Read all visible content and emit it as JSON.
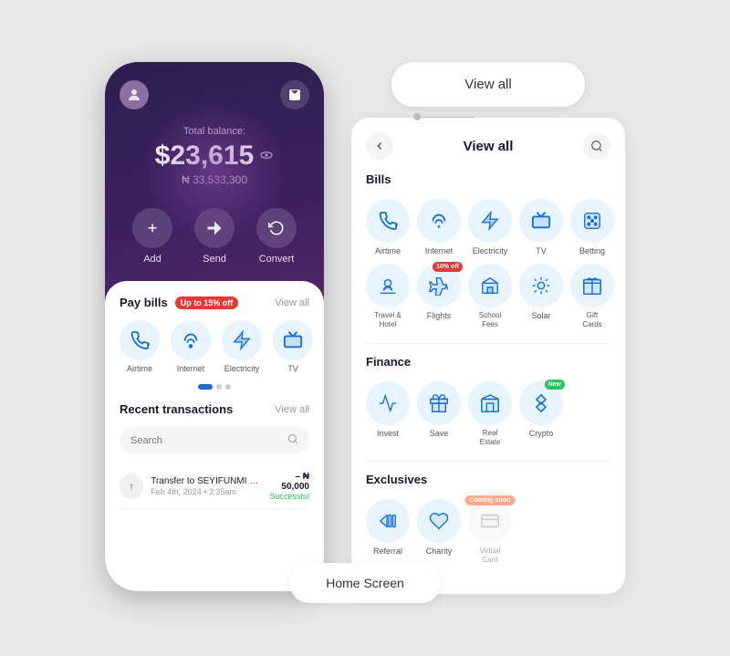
{
  "layout": {
    "background_color": "#e8e8e8"
  },
  "home_screen": {
    "label": "Home Screen",
    "header": {
      "avatar_text": "👤",
      "mail_icon": "✉"
    },
    "balance": {
      "label": "Total balance:",
      "amount": "$23,615",
      "naira": "₦ 33,533,300"
    },
    "actions": [
      {
        "label": "Add",
        "icon": "+"
      },
      {
        "label": "Send",
        "icon": "▲"
      },
      {
        "label": "Convert",
        "icon": "↻"
      }
    ],
    "pay_bills": {
      "title": "Pay bills",
      "badge": "Up to 15% off",
      "view_all": "View all",
      "items": [
        {
          "label": "Airtime",
          "icon": "📞"
        },
        {
          "label": "Internet",
          "icon": "📶"
        },
        {
          "label": "Electricity",
          "icon": "⚡"
        },
        {
          "label": "TV",
          "icon": "📺"
        }
      ]
    },
    "recent_transactions": {
      "title": "Recent transactions",
      "view_all": "View all",
      "search_placeholder": "Search",
      "items": [
        {
          "name": "Transfer to SEYIFUNMI OLUFE...",
          "date": "Feb 4th, 2024 • 3:35am",
          "amount": "– ₦ 50,000",
          "status": "Successful"
        }
      ]
    }
  },
  "view_all_button": {
    "label": "View all"
  },
  "view_all_panel": {
    "title": "View all",
    "back_icon": "←",
    "search_icon": "🔍",
    "bills": {
      "section_title": "Bills",
      "items": [
        {
          "label": "Airtime",
          "icon": "📞",
          "badge": null,
          "disabled": false
        },
        {
          "label": "Internet",
          "icon": "📶",
          "badge": null,
          "disabled": false
        },
        {
          "label": "Electricity",
          "icon": "⚡",
          "badge": null,
          "disabled": false
        },
        {
          "label": "TV",
          "icon": "📺",
          "badge": null,
          "disabled": false
        },
        {
          "label": "Betting",
          "icon": "🎮",
          "badge": null,
          "disabled": false
        },
        {
          "label": "Travel & Hotel",
          "icon": "🏖",
          "badge": null,
          "disabled": false
        },
        {
          "label": "Flights",
          "icon": "✈️",
          "badge": "10% off",
          "badge_color": "red",
          "disabled": false
        },
        {
          "label": "School Fees",
          "icon": "🏫",
          "badge": null,
          "disabled": false
        },
        {
          "label": "Solar",
          "icon": "☀️",
          "badge": null,
          "disabled": false
        },
        {
          "label": "Gift Cards",
          "icon": "🎁",
          "badge": null,
          "disabled": false
        }
      ]
    },
    "finance": {
      "section_title": "Finance",
      "items": [
        {
          "label": "Invest",
          "icon": "📈",
          "badge": null,
          "disabled": false
        },
        {
          "label": "Save",
          "icon": "💰",
          "badge": null,
          "disabled": false
        },
        {
          "label": "Real Estate",
          "icon": "🏢",
          "badge": null,
          "disabled": false
        },
        {
          "label": "Crypto",
          "icon": "💎",
          "badge": "New",
          "badge_color": "green",
          "disabled": false
        }
      ]
    },
    "exclusives": {
      "section_title": "Exclusives",
      "items": [
        {
          "label": "Referral",
          "icon": "📢",
          "badge": null,
          "disabled": false
        },
        {
          "label": "Charity",
          "icon": "🤝",
          "badge": null,
          "disabled": false
        },
        {
          "label": "Virtual Card",
          "icon": "💳",
          "badge": "Coming soon",
          "badge_color": "orange",
          "disabled": true
        }
      ]
    }
  },
  "bottom_label": "Home Screen"
}
